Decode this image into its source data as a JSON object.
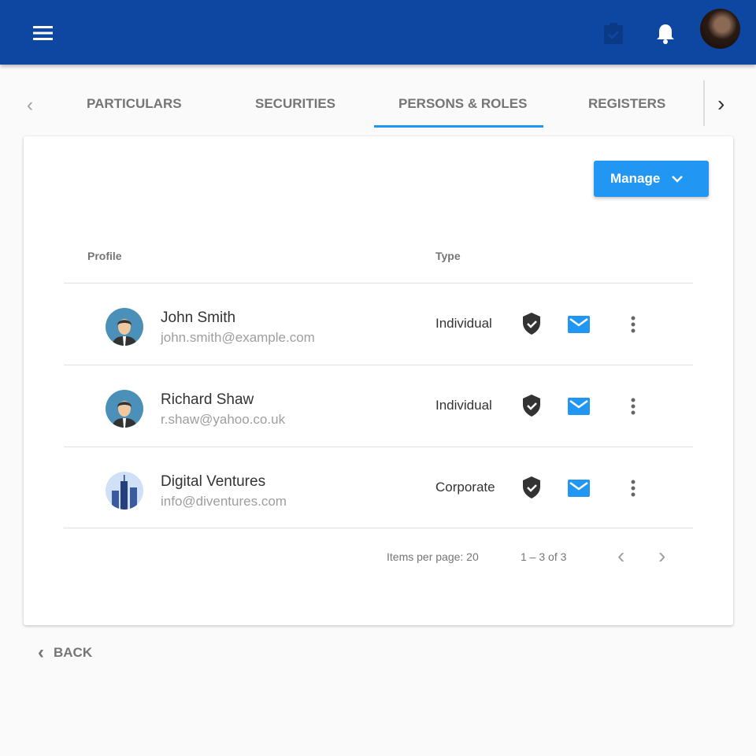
{
  "header": {
    "menu_icon": "menu-icon",
    "task_icon": "clipboard-check-icon",
    "bell_icon": "bell-icon",
    "avatar": "user-avatar"
  },
  "tabs": [
    {
      "label": "PARTICULARS"
    },
    {
      "label": "SECURITIES"
    },
    {
      "label": "PERSONS & ROLES",
      "active": true
    },
    {
      "label": "REGISTERS"
    }
  ],
  "manage_label": "Manage",
  "columns": {
    "profile": "Profile",
    "type": "Type"
  },
  "rows": [
    {
      "name": "John Smith",
      "email": "john.smith@example.com",
      "type": "Individual",
      "avatar": "person"
    },
    {
      "name": "Richard Shaw",
      "email": "r.shaw@yahoo.co.uk",
      "type": "Individual",
      "avatar": "person"
    },
    {
      "name": "Digital Ventures",
      "email": "info@diventures.com",
      "type": "Corporate",
      "avatar": "building"
    }
  ],
  "pagination": {
    "items_per_page_label": "Items per page:",
    "items_per_page": "20",
    "range": "1 – 3 of 3"
  },
  "back_label": "BACK",
  "colors": {
    "primary": "#0d47a1",
    "accent": "#2196f3"
  }
}
